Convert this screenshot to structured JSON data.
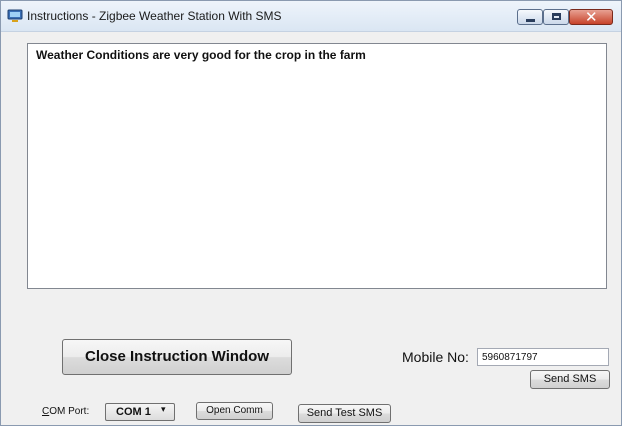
{
  "window": {
    "title": "Instructions - Zigbee Weather Station With SMS",
    "controls": {
      "minimize_icon": "minimize-icon",
      "maximize_icon": "maximize-icon",
      "close_icon": "close-icon",
      "close_glyph": "✕"
    }
  },
  "message": {
    "text": "Weather Conditions are very good for the crop in the farm"
  },
  "buttons": {
    "close_instruction": "Close Instruction Window",
    "send_sms": "Send SMS",
    "open_comm": "Open Comm",
    "send_test_sms": "Send Test SMS"
  },
  "mobile": {
    "label": "Mobile No:",
    "value": "5960871797"
  },
  "com_port": {
    "label_prefix": "C",
    "label_rest": "OM Port:",
    "selected": "COM 1",
    "arrow": "▾"
  },
  "colors": {
    "titlebar": "#dae6f3",
    "window_bg": "#f0f0f0",
    "close_button": "#c7432a"
  }
}
